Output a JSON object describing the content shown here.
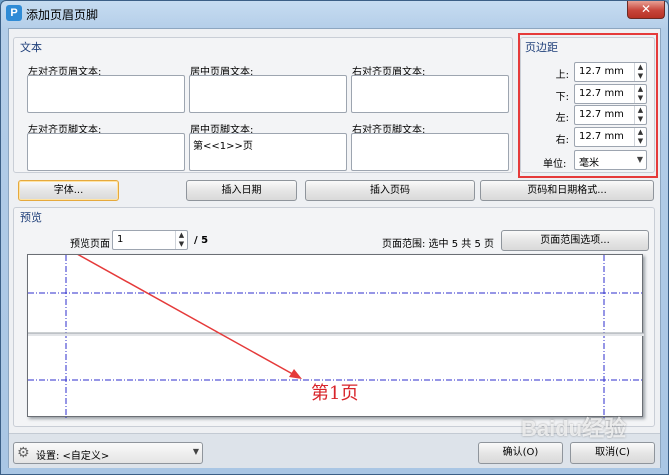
{
  "window": {
    "title": "添加页眉页脚",
    "close_glyph": "✕"
  },
  "text_group": {
    "title": "文本",
    "header_left_label": "左对齐页眉文本:",
    "header_center_label": "居中页眉文本:",
    "header_right_label": "右对齐页眉文本:",
    "footer_left_label": "左对齐页脚文本:",
    "footer_center_label": "居中页脚文本:",
    "footer_right_label": "右对齐页脚文本:",
    "header_left_value": "",
    "header_center_value": "",
    "header_right_value": "",
    "footer_left_value": "",
    "footer_center_value": "第<<1>>页",
    "footer_right_value": ""
  },
  "margin_group": {
    "title": "页边距",
    "top_label": "上:",
    "bottom_label": "下:",
    "left_label": "左:",
    "right_label": "右:",
    "top_value": "12.7 mm",
    "bottom_value": "12.7 mm",
    "left_value": "12.7 mm",
    "right_value": "12.7 mm",
    "unit_label": "单位:",
    "unit_value": "毫米"
  },
  "buttons": {
    "font": "字体...",
    "insert_date": "插入日期",
    "insert_page": "插入页码",
    "page_date_format": "页码和日期格式...",
    "page_range_options": "页面范围选项...",
    "ok": "确认(O)",
    "cancel": "取消(C)"
  },
  "preview_group": {
    "title": "预览",
    "page_label": "预览页面",
    "page_value": "1",
    "page_total": "/ 5",
    "range_text": "页面范围: 选中 5 共 5 页",
    "footer_preview_text": "第1页"
  },
  "settings": {
    "label": "设置: <自定义>"
  },
  "watermark": {
    "text": "Baidu经验"
  },
  "colors": {
    "highlight_box": "#e53a3a",
    "guide_line": "#2d2dcc",
    "preview_text": "#d8242a"
  }
}
